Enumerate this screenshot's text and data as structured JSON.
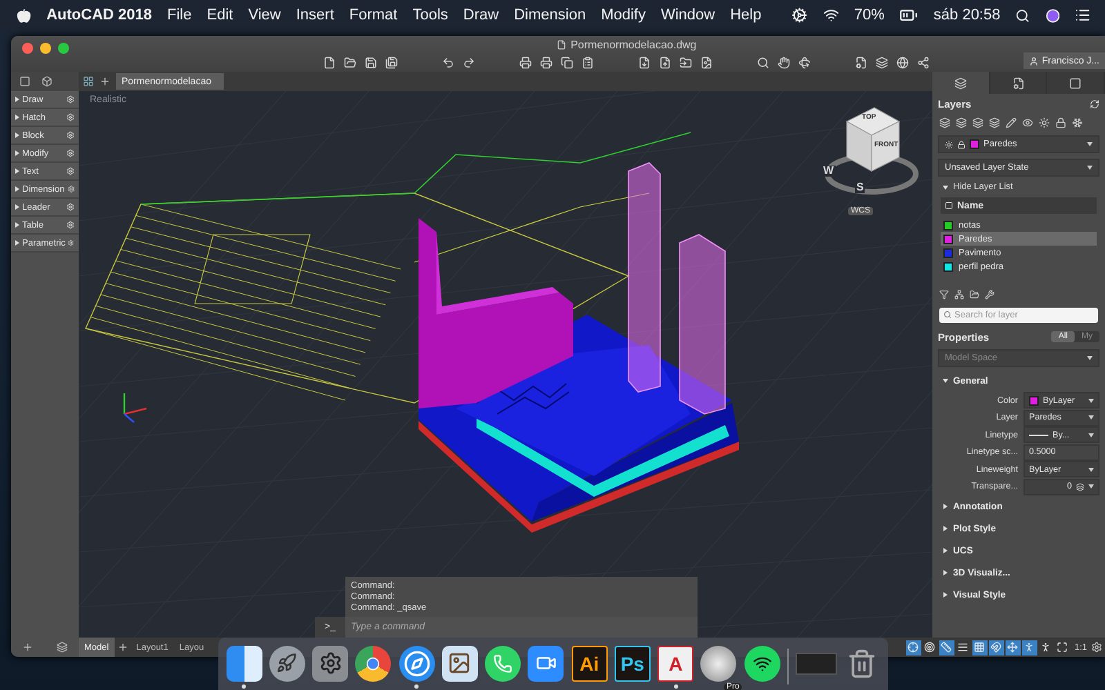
{
  "menu_bar": {
    "app_name": "AutoCAD 2018",
    "menus": [
      "File",
      "Edit",
      "View",
      "Insert",
      "Format",
      "Tools",
      "Draw",
      "Dimension",
      "Modify",
      "Window",
      "Help"
    ],
    "battery": "70%",
    "clock": "sáb 20:58"
  },
  "window": {
    "title": "Pormenormodelacao.dwg",
    "user": "Francisco J..."
  },
  "file_tab": {
    "label": "Pormenormodelacao"
  },
  "tool_palette": {
    "items": [
      {
        "label": "Draw",
        "expanded": false
      },
      {
        "label": "Hatch",
        "expanded": false
      },
      {
        "label": "Block",
        "expanded": false
      },
      {
        "label": "Modify",
        "expanded": false
      },
      {
        "label": "Text",
        "expanded": false
      },
      {
        "label": "Dimension",
        "expanded": false
      },
      {
        "label": "Leader",
        "expanded": false
      },
      {
        "label": "Table",
        "expanded": false
      },
      {
        "label": "Parametric",
        "expanded": false
      }
    ]
  },
  "viewport": {
    "visual_style": "Realistic",
    "viewcube": {
      "top": "TOP",
      "front": "FRONT",
      "west": "W",
      "south": "S",
      "ucs": "WCS"
    }
  },
  "command_line": {
    "prompt": ">_",
    "history": [
      "Command:",
      "Command:",
      "Command: _qsave"
    ],
    "placeholder": "Type a command"
  },
  "layout_tabs": [
    {
      "label": "Model",
      "selected": true
    },
    {
      "label": "Layout1",
      "selected": false
    },
    {
      "label": "Layou",
      "selected": false
    }
  ],
  "panel_tabs": [
    {
      "selected": true
    },
    {
      "selected": false
    },
    {
      "selected": false
    }
  ],
  "layers": {
    "title": "Layers",
    "current": {
      "name": "Paredes",
      "color": "#e020e0"
    },
    "state": "Unsaved Layer State",
    "toggle": "Hide Layer List",
    "column": "Name",
    "rows": [
      {
        "name": "notas",
        "color": "#22cc22",
        "selected": false
      },
      {
        "name": "Paredes",
        "color": "#e020e0",
        "selected": true
      },
      {
        "name": "Pavimento",
        "color": "#1a2be0",
        "selected": false
      },
      {
        "name": "perfil pedra",
        "color": "#10e8e8",
        "selected": false
      }
    ],
    "search": {
      "placeholder": "Search for layer"
    }
  },
  "properties": {
    "title": "Properties",
    "filters": [
      {
        "label": "All",
        "selected": true
      },
      {
        "label": "My",
        "selected": false
      }
    ],
    "space": "Model Space",
    "sections": [
      {
        "label": "General",
        "expanded": true,
        "rows": [
          {
            "label": "Color",
            "value": "ByLayer",
            "kind": "color",
            "color": "#e020e0"
          },
          {
            "label": "Layer",
            "value": "Paredes",
            "kind": "dropdown"
          },
          {
            "label": "Linetype",
            "value": "By...",
            "kind": "linetype"
          },
          {
            "label": "Linetype sc...",
            "value": "0.5000",
            "kind": "field"
          },
          {
            "label": "Lineweight",
            "value": "ByLayer",
            "kind": "dropdown"
          },
          {
            "label": "Transpare...",
            "value": "0",
            "kind": "transparency"
          }
        ]
      },
      {
        "label": "Annotation",
        "expanded": false
      },
      {
        "label": "Plot Style",
        "expanded": false
      },
      {
        "label": "UCS",
        "expanded": false
      },
      {
        "label": "3D Visualiz...",
        "expanded": false
      },
      {
        "label": "Visual Style",
        "expanded": false
      }
    ]
  },
  "status_bar": {
    "toggles": [
      {
        "on": true
      },
      {
        "on": false
      },
      {
        "on": true
      },
      {
        "on": false
      },
      {
        "on": true
      },
      {
        "on": true
      },
      {
        "on": true
      },
      {
        "on": true
      },
      {
        "on": false
      },
      {
        "on": false
      }
    ],
    "scale": "1:1"
  },
  "dock": {
    "apps": [
      {
        "kind": "finder",
        "running": true
      },
      {
        "kind": "launchpad",
        "running": false
      },
      {
        "kind": "settings",
        "running": false
      },
      {
        "kind": "chrome",
        "running": false
      },
      {
        "kind": "safari",
        "running": true
      },
      {
        "kind": "preview",
        "running": false
      },
      {
        "kind": "whatsapp",
        "running": false
      },
      {
        "kind": "zoom",
        "running": false
      },
      {
        "kind": "dark-tile",
        "label": "Ai",
        "color": "#ff9a00",
        "running": false
      },
      {
        "kind": "dark-tile",
        "label": "Ps",
        "color": "#31c5f0",
        "running": false
      },
      {
        "kind": "light-tile",
        "label": "A",
        "color": "#d0202a",
        "running": true
      },
      {
        "kind": "pro-app",
        "label": "Pro",
        "running": false
      },
      {
        "kind": "spotify",
        "running": false
      },
      {
        "kind": "separator"
      },
      {
        "kind": "window-thumb"
      },
      {
        "kind": "trash"
      }
    ]
  }
}
